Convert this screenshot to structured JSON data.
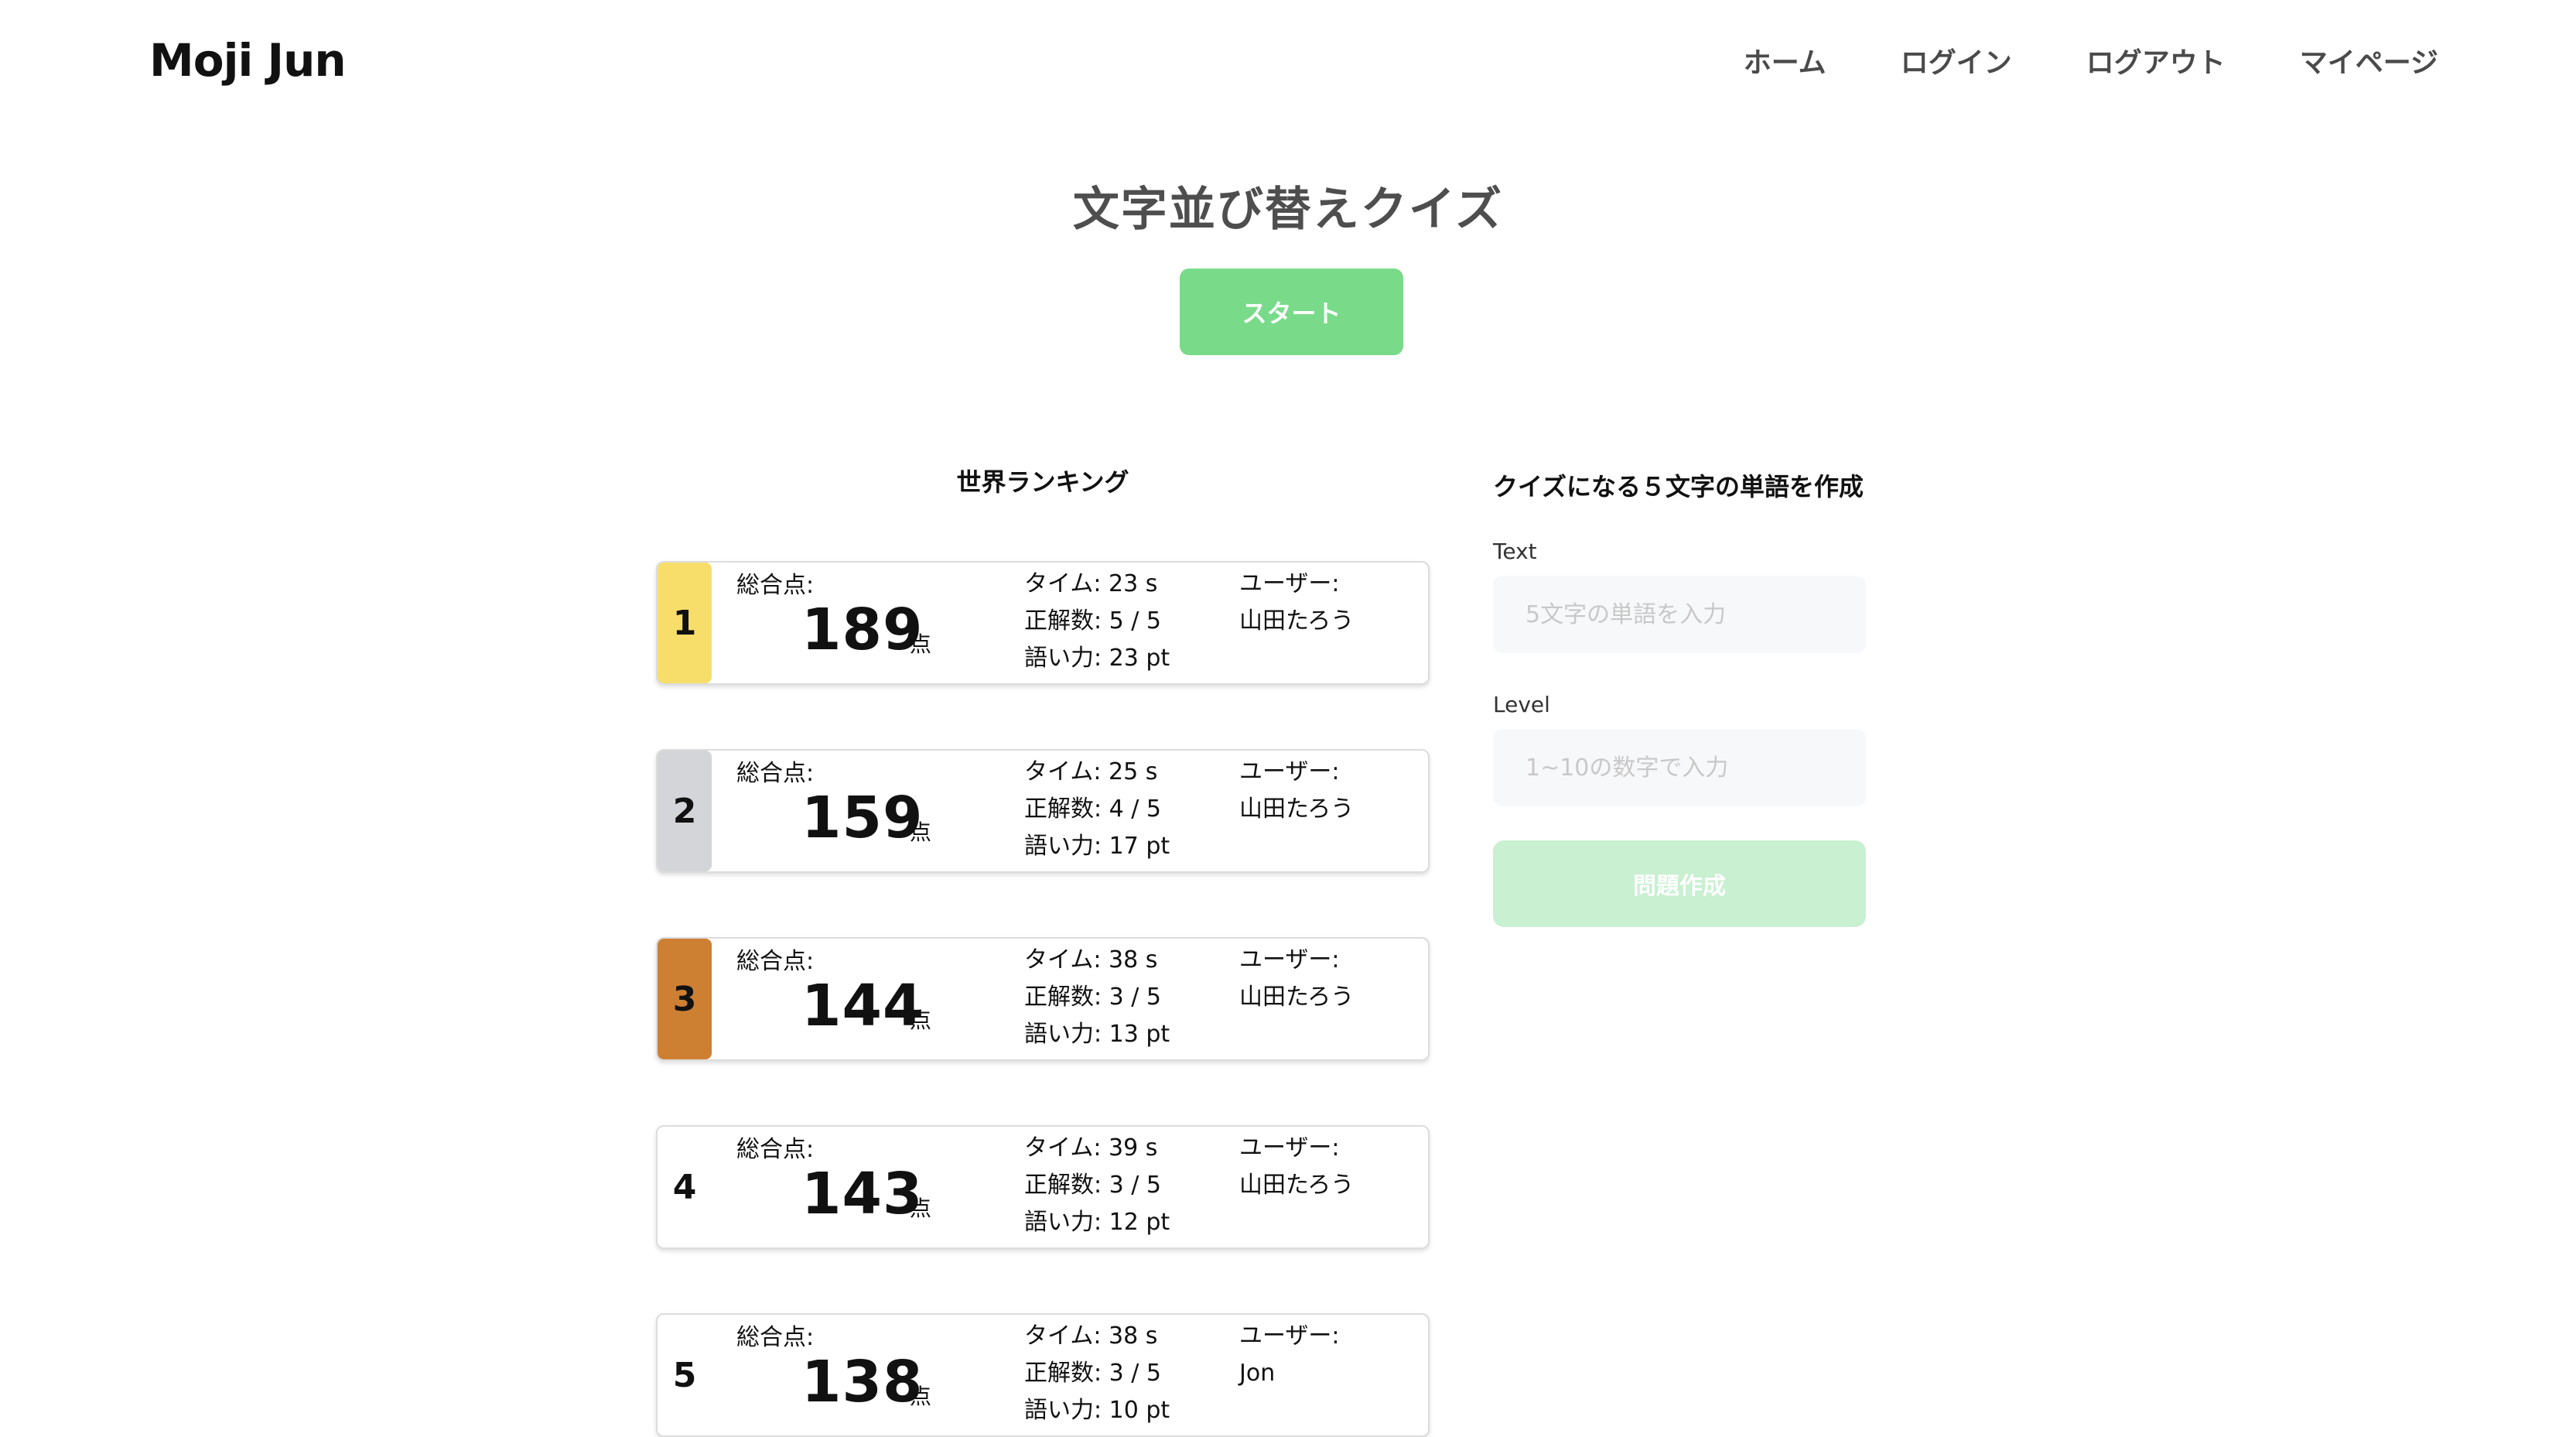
{
  "header": {
    "brand": "Moji Jun",
    "nav": [
      "ホーム",
      "ログイン",
      "ログアウト",
      "マイページ"
    ]
  },
  "main": {
    "title": "文字並び替えクイズ",
    "start_label": "スタート"
  },
  "ranking": {
    "heading": "世界ランキング",
    "score_label": "総合点:",
    "score_unit": "点",
    "user_label": "ユーザー:",
    "entries": [
      {
        "rank": "1",
        "score": "189",
        "time": "タイム: 23 s",
        "correct": "正解数: 5 / 5",
        "vocab": "語い力: 23 pt",
        "user": "山田たろう",
        "badge_color": "#f7de6a"
      },
      {
        "rank": "2",
        "score": "159",
        "time": "タイム: 25 s",
        "correct": "正解数: 4 / 5",
        "vocab": "語い力: 17 pt",
        "user": "山田たろう",
        "badge_color": "#d4d5d8"
      },
      {
        "rank": "3",
        "score": "144",
        "time": "タイム: 38 s",
        "correct": "正解数: 3 / 5",
        "vocab": "語い力: 13 pt",
        "user": "山田たろう",
        "badge_color": "#cd7f32"
      },
      {
        "rank": "4",
        "score": "143",
        "time": "タイム: 39 s",
        "correct": "正解数: 3 / 5",
        "vocab": "語い力: 12 pt",
        "user": "山田たろう",
        "badge_color": "#ffffff"
      },
      {
        "rank": "5",
        "score": "138",
        "time": "タイム: 38 s",
        "correct": "正解数: 3 / 5",
        "vocab": "語い力: 10 pt",
        "user": "Jon",
        "badge_color": "#ffffff"
      }
    ]
  },
  "create": {
    "heading": "クイズになる５文字の単語を作成",
    "text_label": "Text",
    "text_placeholder": "5文字の単語を入力",
    "level_label": "Level",
    "level_placeholder": "1~10の数字で入力",
    "submit_label": "問題作成"
  },
  "colors": {
    "accent": "#79db8a",
    "accent_disabled": "#c9f0d1",
    "input_bg": "#f7f8fa"
  }
}
